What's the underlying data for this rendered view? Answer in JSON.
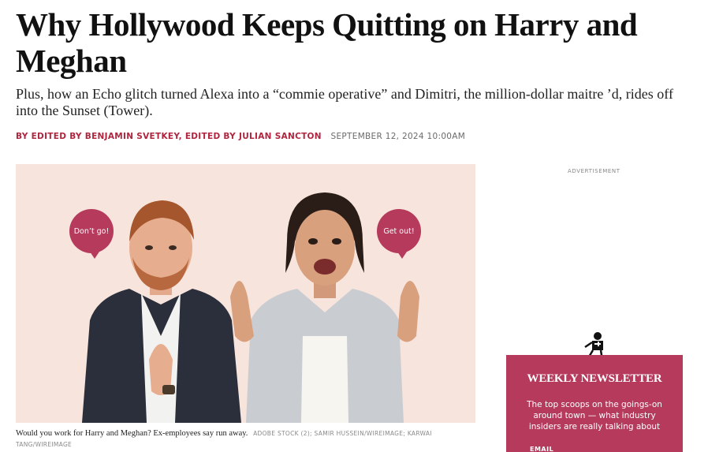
{
  "article": {
    "headline": "Why Hollywood Keeps Quitting on Harry and Meghan",
    "dek": "Plus, how an Echo glitch turned Alexa into a “commie operative” and Dimitri, the million-dollar maitre ’d, rides off into the Sunset (Tower).",
    "byline": "BY EDITED BY BENJAMIN SVETKEY, EDITED BY JULIAN SANCTON",
    "date": "SEPTEMBER 12, 2024 10:00AM"
  },
  "hero": {
    "bubble_left": "Don’t go!",
    "bubble_right": "Get out!",
    "background_color": "#f7e4dc",
    "bubble_color": "#b53a5c"
  },
  "caption": {
    "text": "Would you work for Harry and Meghan? Ex-employees say run away.",
    "credit": "ADOBE STOCK (2); SAMIR HUSSEIN/WIREIMAGE; KARWAI TANG/WIREIMAGE"
  },
  "sidebar": {
    "ad_label": "ADVERTISEMENT",
    "newsletter": {
      "title": "WEEKLY NEWSLETTER",
      "body": "The top scoops on the goings-on around town — what industry insiders are really talking about",
      "email_label": "EMAIL",
      "color": "#b53a5c"
    }
  },
  "colors": {
    "accent": "#b0253f",
    "text": "#111111",
    "muted": "#6b6b6b"
  }
}
